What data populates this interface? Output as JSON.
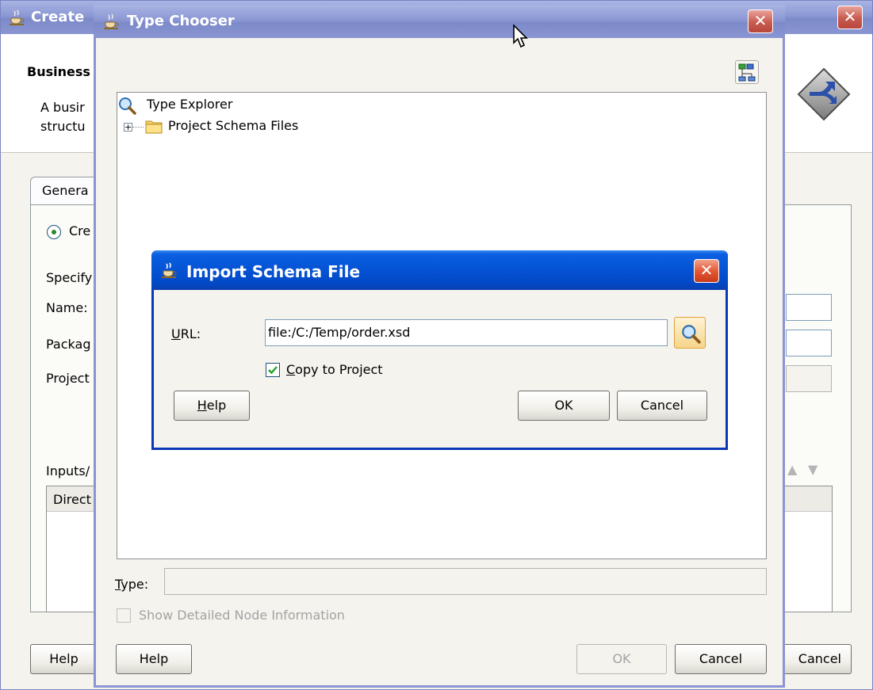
{
  "create_window": {
    "title": "Create",
    "header_title": "Business",
    "header_desc_line1": "A busir",
    "header_desc_line2": "structu",
    "tab_general": "Genera",
    "radio_create": "Cre",
    "specify_label": "Specify",
    "name_label": "Name:",
    "package_label": "Packag",
    "project_label": "Project",
    "inputs_label": "Inputs/",
    "table_header": "Direct",
    "help_button": "Help",
    "cancel_button": "Cancel"
  },
  "type_chooser": {
    "title": "Type Chooser",
    "tree_root": "Type Explorer",
    "tree_child": "Project Schema Files",
    "type_label": "Type:",
    "type_value": "",
    "show_detail_label": "Show Detailed Node Information",
    "help_button": "Help",
    "ok_button": "OK",
    "cancel_button": "Cancel"
  },
  "import_dialog": {
    "title": "Import Schema File",
    "url_label": "URL:",
    "url_value": "file:/C:/Temp/order.xsd",
    "copy_label": "Copy to Project",
    "copy_checked": true,
    "help_button": "Help",
    "ok_button": "OK",
    "cancel_button": "Cancel"
  },
  "icons": [
    "java-cup-icon",
    "close-icon",
    "hierarchy-icon",
    "search-icon",
    "folder-icon",
    "expand-plus-icon",
    "arrows-diamond-icon",
    "mouse-cursor-icon"
  ],
  "colors": {
    "import_titlebar": "#0654d6",
    "inactive_titlebar": "#8c98d4",
    "close_button": "#c85a4f",
    "dialog_bg": "#f4f3ee"
  }
}
